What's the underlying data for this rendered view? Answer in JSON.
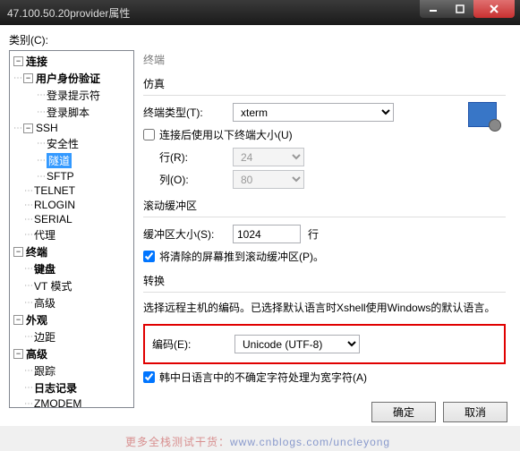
{
  "window": {
    "title": "47.100.50.20provider属性"
  },
  "category_label": "类别(C):",
  "tree": {
    "connection": "连接",
    "auth": "用户身份验证",
    "login_prompt": "登录提示符",
    "login_script": "登录脚本",
    "ssh": "SSH",
    "security": "安全性",
    "tunnel": "隧道",
    "sftp": "SFTP",
    "telnet": "TELNET",
    "rlogin": "RLOGIN",
    "serial": "SERIAL",
    "proxy": "代理",
    "terminal": "终端",
    "keyboard": "键盘",
    "vtmode": "VT 模式",
    "advanced": "高级",
    "appearance": "外观",
    "margin": "边距",
    "advanced2": "高级",
    "trace": "跟踪",
    "logging": "日志记录",
    "zmodem": "ZMODEM"
  },
  "content": {
    "section_terminal": "终端",
    "group_emulation": "仿真",
    "terminal_type_label": "终端类型(T):",
    "terminal_type_value": "xterm",
    "use_size_label": "连接后使用以下终端大小(U)",
    "rows_label": "行(R):",
    "rows_value": "24",
    "cols_label": "列(O):",
    "cols_value": "80",
    "group_scrollback": "滚动缓冲区",
    "buffer_size_label": "缓冲区大小(S):",
    "buffer_size_value": "1024",
    "buffer_unit": "行",
    "push_clear_label": "将清除的屏幕推到滚动缓冲区(P)。",
    "group_translation": "转换",
    "translation_desc": "选择远程主机的编码。已选择默认语言时Xshell使用Windows的默认语言。",
    "encoding_label": "编码(E):",
    "encoding_value": "Unicode (UTF-8)",
    "cjk_label": "韩中日语言中的不确定字符处理为宽字符(A)"
  },
  "buttons": {
    "ok": "确定",
    "cancel": "取消"
  },
  "watermark": {
    "text": "更多全栈测试干货：",
    "url": "www.cnblogs.com/uncleyong"
  }
}
